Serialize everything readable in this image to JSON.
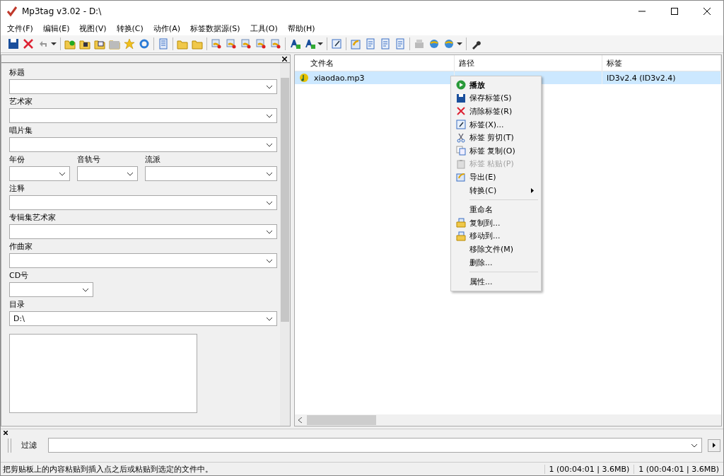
{
  "window": {
    "title": "Mp3tag v3.02  -  D:\\"
  },
  "menu": [
    "文件(F)",
    "编辑(E)",
    "视图(V)",
    "转换(C)",
    "动作(A)",
    "标签数据源(S)",
    "工具(O)",
    "帮助(H)"
  ],
  "tag_panel": {
    "fields": [
      {
        "kind": "full",
        "label": "标题"
      },
      {
        "kind": "full",
        "label": "艺术家"
      },
      {
        "kind": "full",
        "label": "唱片集"
      },
      {
        "kind": "triple",
        "items": [
          {
            "label": "年份"
          },
          {
            "label": "音轨号"
          },
          {
            "label": "流派"
          }
        ]
      },
      {
        "kind": "full",
        "label": "注释"
      },
      {
        "kind": "full",
        "label": "专辑集艺术家"
      },
      {
        "kind": "full",
        "label": "作曲家"
      },
      {
        "kind": "narrow",
        "label": "CD号"
      },
      {
        "kind": "full",
        "label": "目录",
        "value": "D:\\"
      }
    ]
  },
  "file_list": {
    "columns": [
      "文件名",
      "路径",
      "标签"
    ],
    "rows": [
      {
        "filename": "xiaodao.mp3",
        "tag": "ID3v2.4 (ID3v2.4)",
        "selected": true
      }
    ]
  },
  "context_menu": [
    {
      "kind": "item",
      "label": "播放",
      "bold": true,
      "disabled": false
    },
    {
      "kind": "item",
      "label": "保存标签(S)",
      "bold": false,
      "disabled": false
    },
    {
      "kind": "item",
      "label": "清除标签(R)",
      "bold": false,
      "disabled": false
    },
    {
      "kind": "item",
      "label": "标签(X)...",
      "bold": false,
      "disabled": false
    },
    {
      "kind": "item",
      "label": "标签 剪切(T)",
      "bold": false,
      "disabled": false
    },
    {
      "kind": "item",
      "label": "标签 复制(O)",
      "bold": false,
      "disabled": false
    },
    {
      "kind": "item",
      "label": "标签 粘贴(P)",
      "bold": false,
      "disabled": true
    },
    {
      "kind": "item",
      "label": "导出(E)",
      "bold": false,
      "disabled": false
    },
    {
      "kind": "submenu",
      "label": "转换(C)",
      "bold": false,
      "disabled": false
    },
    {
      "kind": "separator"
    },
    {
      "kind": "item",
      "label": "重命名",
      "bold": false,
      "disabled": false
    },
    {
      "kind": "item",
      "label": "复制到...",
      "bold": false,
      "disabled": false
    },
    {
      "kind": "item",
      "label": "移动到...",
      "bold": false,
      "disabled": false
    },
    {
      "kind": "item",
      "label": "移除文件(M)",
      "bold": false,
      "disabled": false
    },
    {
      "kind": "item",
      "label": "删除...",
      "bold": false,
      "disabled": false
    },
    {
      "kind": "separator"
    },
    {
      "kind": "item",
      "label": "属性...",
      "bold": false,
      "disabled": false
    }
  ],
  "filter": {
    "label": "过滤"
  },
  "status_bar": {
    "message": "把剪贴板上的内容粘贴到插入点之后或粘贴到选定的文件中。",
    "selected_count": "1 (00:04:01 | 3.6MB)",
    "total_count": "1 (00:04:01 | 3.6MB)"
  }
}
